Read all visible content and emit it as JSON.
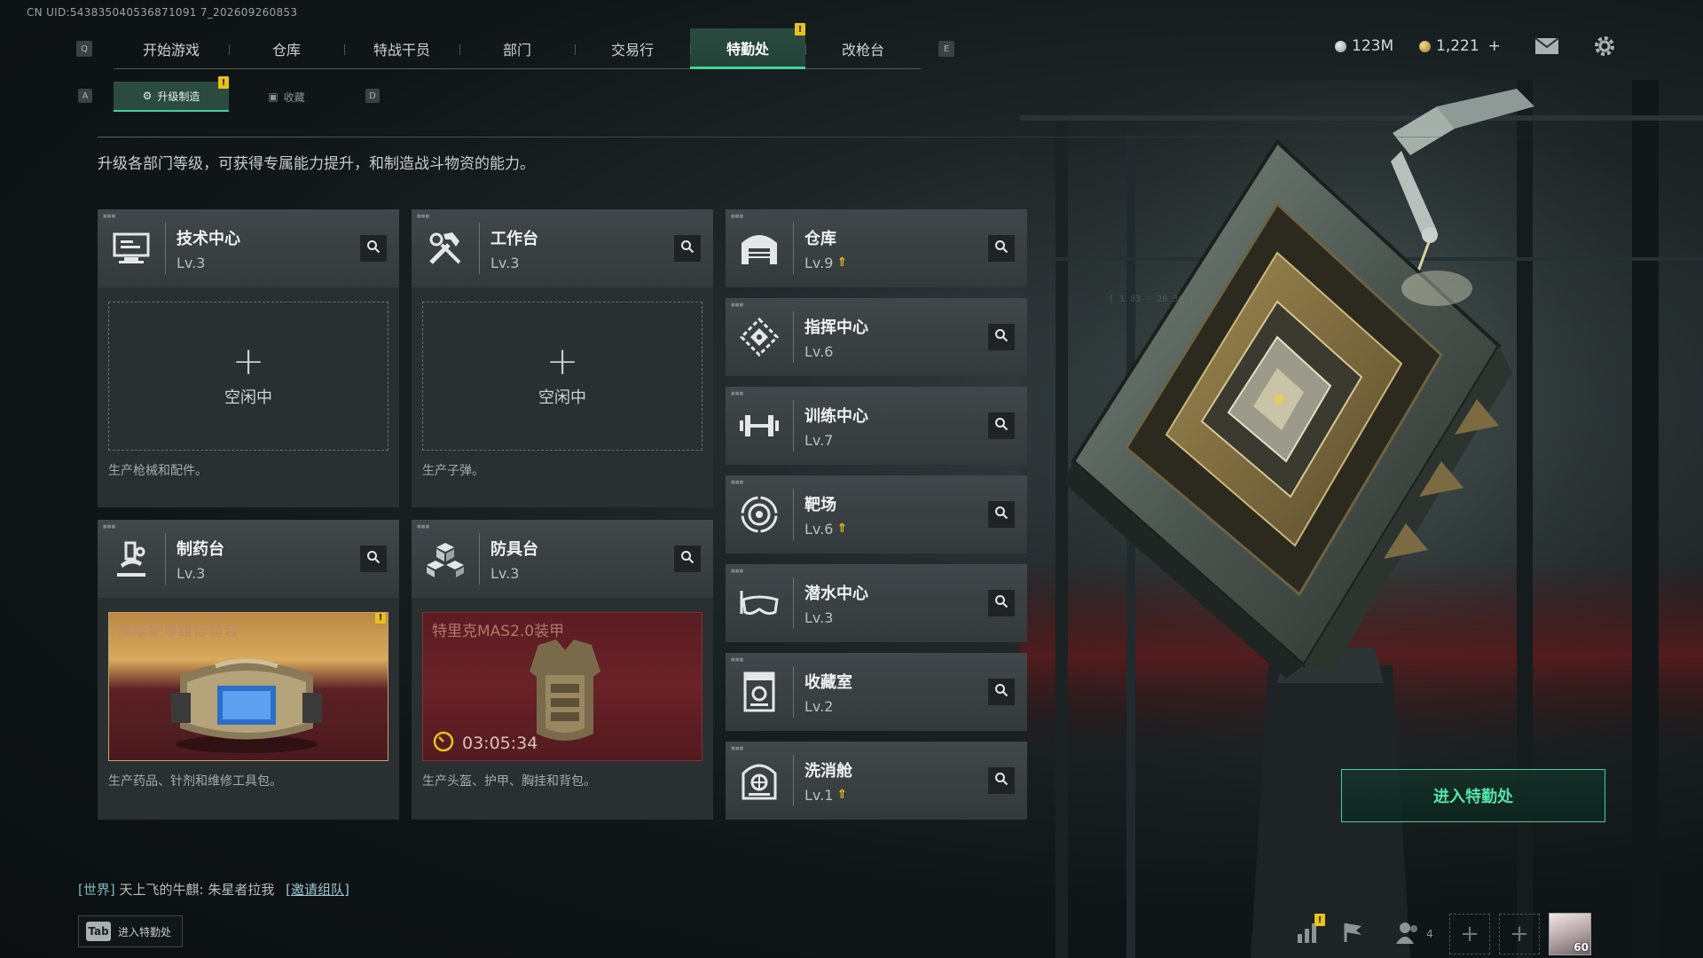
{
  "uid_text": "CN UID:543835040536871091 7_202609260853",
  "keys": {
    "left": "Q",
    "right": "E",
    "sub_left": "A",
    "sub_right": "D"
  },
  "nav": {
    "tabs": [
      {
        "label": "开始游戏"
      },
      {
        "label": "仓库"
      },
      {
        "label": "特战干员"
      },
      {
        "label": "部门"
      },
      {
        "label": "交易行"
      },
      {
        "label": "特勤处",
        "active": true,
        "alert": "!"
      },
      {
        "label": "改枪台"
      }
    ]
  },
  "currency": {
    "silver": "123M",
    "gold": "1,221",
    "gold_add": "+"
  },
  "subnav": {
    "tabs": [
      {
        "label": "升级制造",
        "active": true,
        "alert": "!"
      },
      {
        "label": "收藏"
      }
    ]
  },
  "description": "升级各部门等级，可获得专属能力提升，和制造战斗物资的能力。",
  "workshops": [
    {
      "name": "技术中心",
      "level": "Lv.3",
      "icon": "computer-icon",
      "slot": {
        "state": "idle",
        "label": "空闲中"
      },
      "desc": "生产枪械和配件。"
    },
    {
      "name": "工作台",
      "level": "Lv.3",
      "icon": "tools-icon",
      "slot": {
        "state": "idle",
        "label": "空闲中"
      },
      "desc": "生产子弹。"
    },
    {
      "name": "制药台",
      "level": "Lv.3",
      "icon": "microscope-icon",
      "slot": {
        "state": "complete",
        "item": "高级护甲维修组合",
        "alert": "!"
      },
      "desc": "生产药品、针剂和维修工具包。"
    },
    {
      "name": "防具台",
      "level": "Lv.3",
      "icon": "cubes-icon",
      "slot": {
        "state": "producing",
        "item": "特里克MAS2.0装甲",
        "timer": "03:05:34"
      },
      "desc": "生产头盔、护甲、胸挂和背包。"
    }
  ],
  "departments": [
    {
      "name": "仓库",
      "level": "Lv.9",
      "upgradable": true,
      "icon": "warehouse-icon"
    },
    {
      "name": "指挥中心",
      "level": "Lv.6",
      "upgradable": false,
      "icon": "command-icon"
    },
    {
      "name": "训练中心",
      "level": "Lv.7",
      "upgradable": false,
      "icon": "dumbbell-icon"
    },
    {
      "name": "靶场",
      "level": "Lv.6",
      "upgradable": true,
      "icon": "target-icon"
    },
    {
      "name": "潜水中心",
      "level": "Lv.3",
      "upgradable": false,
      "icon": "diving-mask-icon"
    },
    {
      "name": "收藏室",
      "level": "Lv.2",
      "upgradable": false,
      "icon": "collection-icon"
    },
    {
      "name": "洗消舱",
      "level": "Lv.1",
      "upgradable": true,
      "icon": "decon-icon"
    }
  ],
  "enter_button": "进入特勤处",
  "chat": {
    "channel": "[世界]",
    "sender": "天上飞的牛麒",
    "message": ": 朱星者拉我",
    "link": "[邀请组队]"
  },
  "tab_hint": {
    "key": "Tab",
    "label": "进入特勤处"
  },
  "bottom": {
    "squad_count": "4",
    "level": "60",
    "stats_alert": "!"
  },
  "colors": {
    "accent": "#41d39a",
    "alert": "#e8c21c",
    "panel": "#3a3f41",
    "complete_bg": "#d9a95c",
    "producing_bg": "#6a2228"
  }
}
